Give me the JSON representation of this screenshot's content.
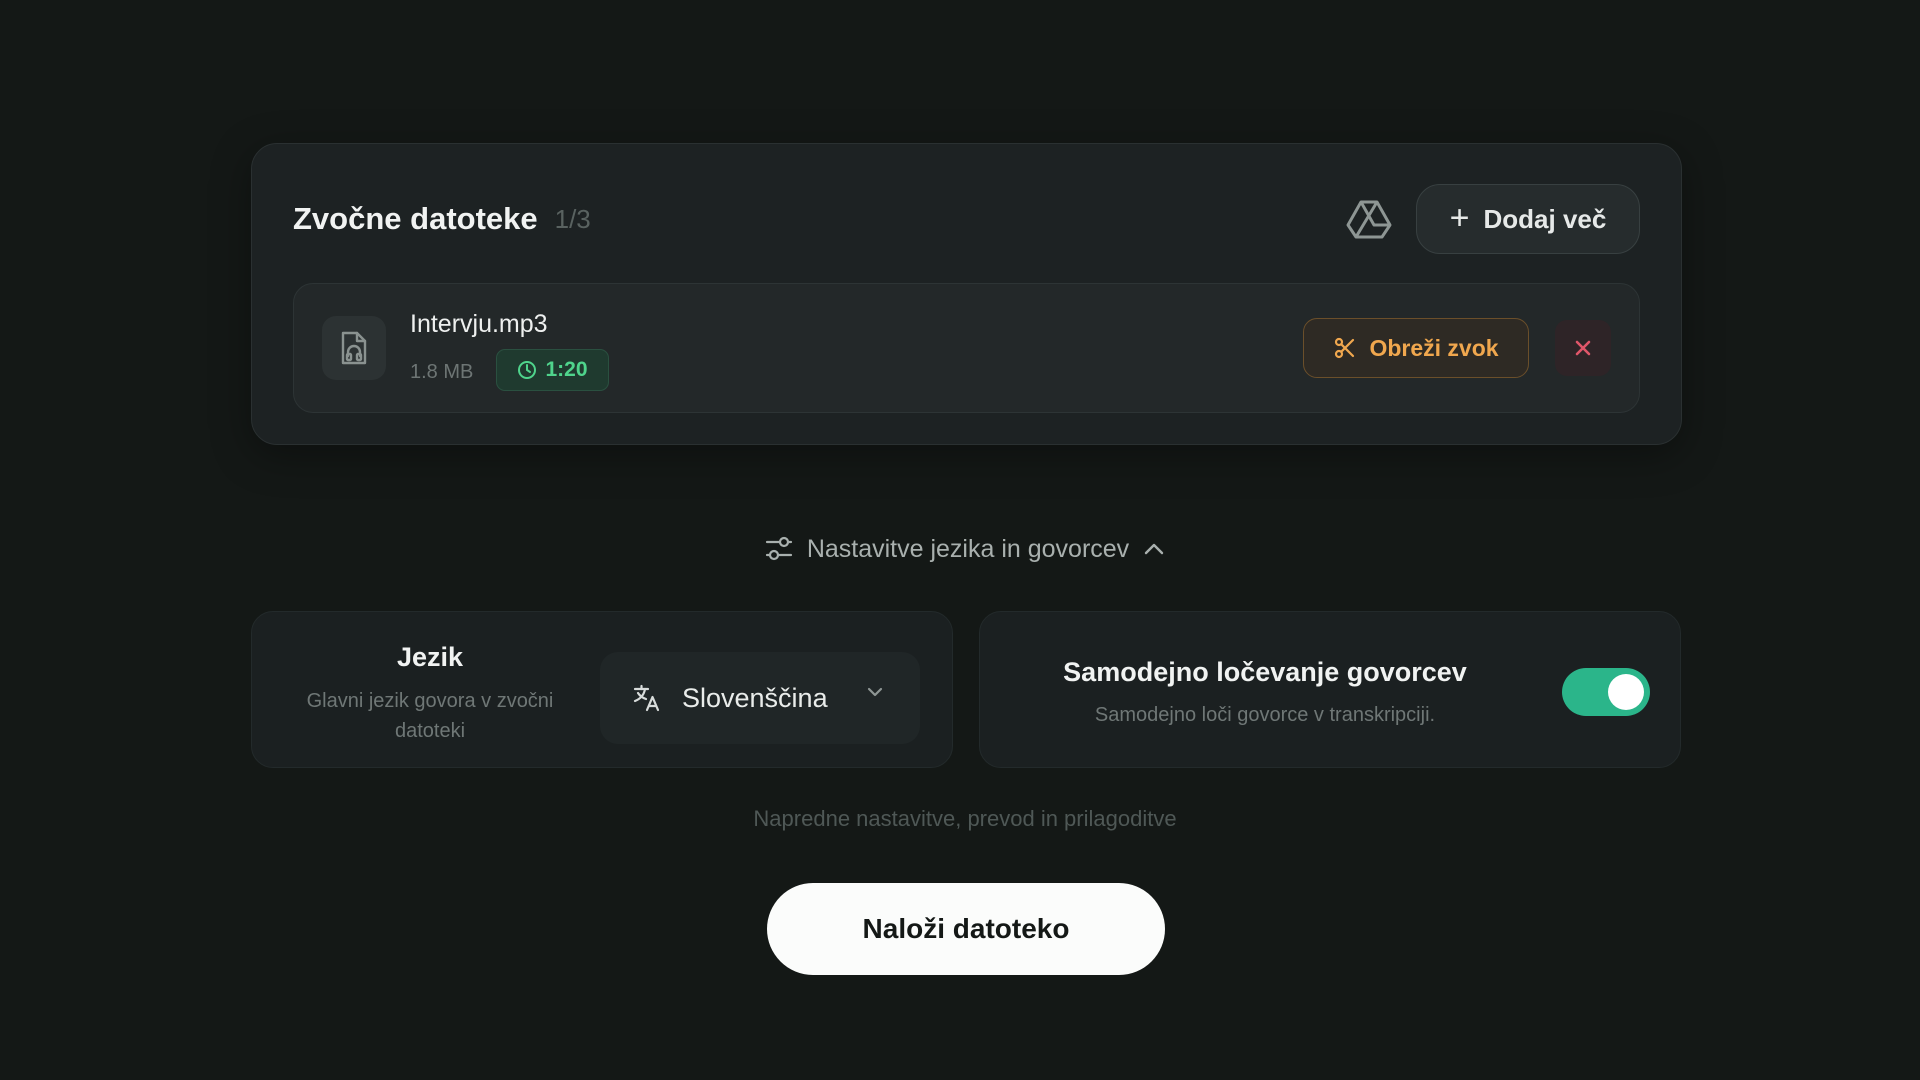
{
  "files": {
    "title": "Zvočne datoteke",
    "count": "1/3",
    "drive_icon": "google-drive-icon",
    "add_more_label": "Dodaj več",
    "items": [
      {
        "name": "Intervju.mp3",
        "size": "1.8 MB",
        "duration": "1:20",
        "trim_label": "Obreži zvok"
      }
    ]
  },
  "settings": {
    "toggle_label": "Nastavitve jezika in govorcev",
    "language": {
      "title": "Jezik",
      "description": "Glavni jezik govora v zvočni datoteki",
      "selected": "Slovenščina"
    },
    "diarization": {
      "title": "Samodejno ločevanje govorcev",
      "description": "Samodejno loči govorce v transkripciji.",
      "enabled": true
    },
    "advanced_label": "Napredne nastavitve, prevod in prilagoditve"
  },
  "upload_label": "Naloži datoteko",
  "colors": {
    "background": "#141816",
    "accent_green": "#2bb58a",
    "duration_green": "#4fd48c",
    "trim_orange": "#f0a74e",
    "remove_red": "#e0566a"
  }
}
